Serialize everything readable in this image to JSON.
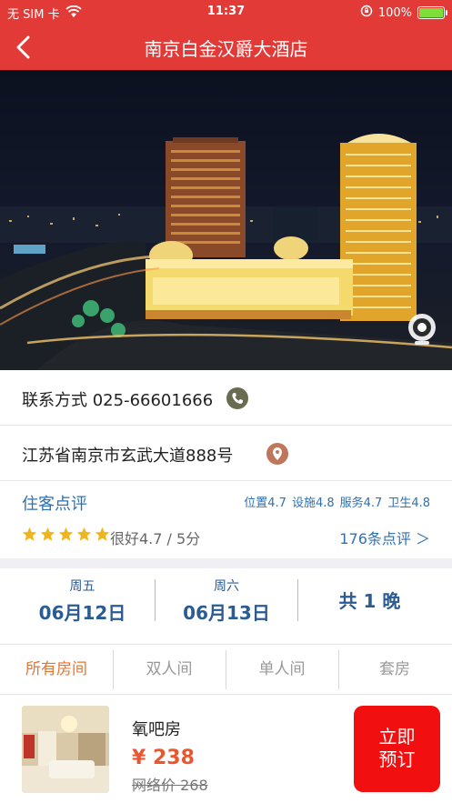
{
  "status_bar": {
    "carrier": "无 SIM 卡",
    "time": "11:37",
    "battery": "100%",
    "battery_level": 1.0
  },
  "nav": {
    "title": "南京白金汉爵大酒店",
    "back_icon": "chevron-left-icon"
  },
  "contact": {
    "label": "联系方式 025-66601666",
    "icon": "phone-icon"
  },
  "address": {
    "text": "江苏省南京市玄武大道888号",
    "icon": "location-pin-icon"
  },
  "review": {
    "title": "住客点评",
    "scores": [
      "位置4.7",
      "设施4.8",
      "服务4.7",
      "卫生4.8"
    ],
    "star_count": 5,
    "rating_text": "很好4.7 / 5分",
    "count_text": "176条点评 ＞"
  },
  "dates": {
    "checkin_weekday": "周五",
    "checkin_date": "06月12日",
    "checkout_weekday": "周六",
    "checkout_date": "06月13日",
    "nights": "共 1 晚"
  },
  "tabs": [
    "所有房间",
    "双人间",
    "单人间",
    "套房"
  ],
  "active_tab": 0,
  "room": {
    "name": "氧吧房",
    "price": "¥ 238",
    "original_price": "网络价 268"
  },
  "book_button": {
    "line1": "立即",
    "line2": "预订"
  },
  "colors": {
    "brand_red": "#e23a36",
    "link_blue": "#2f70b3",
    "accent_orange": "#e8742f",
    "button_red": "#f20f0f"
  }
}
